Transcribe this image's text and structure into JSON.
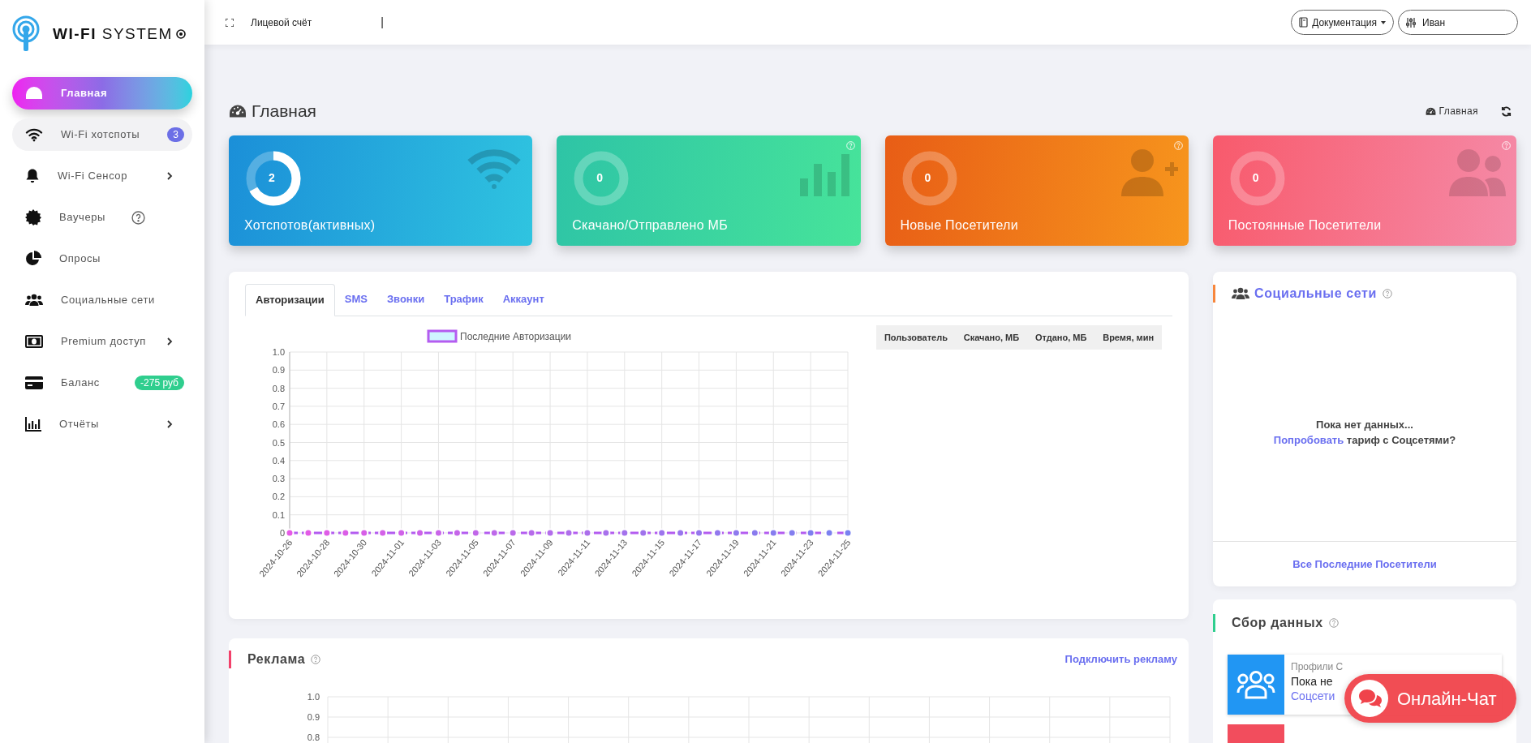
{
  "brand": {
    "title_bold": "WI-FI",
    "title_light": "SYSTEM"
  },
  "sidebar": {
    "items": [
      {
        "label": "Главная",
        "selected": true,
        "hovered": false,
        "expandable": false,
        "help": false
      },
      {
        "label": "Wi-Fi хотспоты",
        "selected": false,
        "hovered": true,
        "expandable": false,
        "help": false,
        "badge": {
          "text": "3",
          "color": "#6c6fe6"
        }
      },
      {
        "label": "Wi-Fi Сенсор",
        "selected": false,
        "hovered": false,
        "expandable": true,
        "help": false
      },
      {
        "label": "Ваучеры",
        "selected": false,
        "hovered": false,
        "expandable": false,
        "help": true
      },
      {
        "label": "Опросы",
        "selected": false,
        "hovered": false,
        "expandable": false,
        "help": false
      },
      {
        "label": "Социальные сети",
        "selected": false,
        "hovered": false,
        "expandable": false,
        "help": false
      },
      {
        "label": "Premium доступ",
        "selected": false,
        "hovered": false,
        "expandable": true,
        "help": false
      },
      {
        "label": "Баланс",
        "selected": false,
        "hovered": false,
        "expandable": false,
        "help": false,
        "badge": {
          "text": "-275 руб",
          "color": "#2fce8e"
        }
      },
      {
        "label": "Отчёты",
        "selected": false,
        "hovered": false,
        "expandable": true,
        "help": false
      }
    ]
  },
  "topbar": {
    "account_label": "Лицевой счёт",
    "separator": "|",
    "docs_button": "Документация",
    "user_field": "Иван"
  },
  "page": {
    "title": "Главная",
    "breadcrumb": "Главная"
  },
  "cards": [
    {
      "value": "2",
      "label": "Хотспотов(активных)",
      "level": 0.67,
      "help": false,
      "color": "#1b8fd8"
    },
    {
      "value": "0",
      "label": "Скачано/Отправлено МБ",
      "level": 0,
      "help": true,
      "color": "#2ec4a6"
    },
    {
      "value": "0",
      "label": "Новые Посетители",
      "level": 0,
      "help": true,
      "color": "#e85d16"
    },
    {
      "value": "0",
      "label": "Постоянные Посетители",
      "level": 0,
      "help": true,
      "color": "#f85a6c"
    }
  ],
  "stats": {
    "tabs": [
      {
        "label": "Авторизации",
        "selected": true
      },
      {
        "label": "SMS",
        "selected": false
      },
      {
        "label": "Звонки",
        "selected": false
      },
      {
        "label": "Трафик",
        "selected": false
      },
      {
        "label": "Аккаунт",
        "selected": false
      }
    ],
    "chart_data": {
      "type": "line",
      "categories": [
        "2024-10-26",
        null,
        "2024-10-28",
        null,
        "2024-10-30",
        null,
        "2024-11-01",
        null,
        "2024-11-03",
        null,
        "2024-11-05",
        null,
        "2024-11-07",
        null,
        "2024-11-09",
        null,
        "2024-11-11",
        null,
        "2024-11-13",
        null,
        "2024-11-15",
        null,
        "2024-11-17",
        null,
        "2024-11-19",
        null,
        "2024-11-21",
        null,
        "2024-11-23",
        null,
        "2024-11-25"
      ],
      "grid": true,
      "series": [
        {
          "name": "Последние Авторизации",
          "color": "#b45cf0",
          "line_style": "dashed",
          "marker": "circle",
          "values": [
            0,
            0,
            0,
            0,
            0,
            0,
            0,
            0,
            0,
            0,
            0,
            0,
            0,
            0,
            0,
            0,
            0,
            0,
            0,
            0,
            0,
            0,
            0,
            0,
            0,
            0,
            0,
            0,
            0,
            0,
            0
          ]
        }
      ],
      "ylim": [
        0,
        1
      ],
      "yticks": [
        {
          "value": 1,
          "label": "1.0"
        },
        {
          "value": 0.9,
          "label": "0.9"
        },
        {
          "value": 0.8,
          "label": "0.8"
        },
        {
          "value": 0.7,
          "label": "0.7"
        },
        {
          "value": 0.6,
          "label": "0.6"
        },
        {
          "value": 0.5,
          "label": "0.5"
        },
        {
          "value": 0.4,
          "label": "0.4"
        },
        {
          "value": 0.3,
          "label": "0.3"
        },
        {
          "value": 0.2,
          "label": "0.2"
        },
        {
          "value": 0.1,
          "label": "0.1"
        },
        {
          "value": 0,
          "label": "0"
        }
      ]
    },
    "table": {
      "columns": [
        "Пользователь",
        "Скачано, МБ",
        "Отдано, МБ",
        "Время, мин"
      ]
    }
  },
  "ads": {
    "title": "Реклама",
    "link": "Подключить рекламу",
    "axis_labels": [
      "1.0",
      "0.9",
      "0.8"
    ]
  },
  "social": {
    "title": "Социальные сети",
    "empty_text": "Пока нет данных...",
    "link": "Попробовать",
    "link_suffix": "тариф с Соцсетями?",
    "footer_link": "Все Последние Посетители"
  },
  "data_collection": {
    "title": "Сбор данных",
    "items": [
      {
        "color": "#2196f3",
        "caption": "Профили С",
        "text": "Пока не",
        "link": "Соцсети"
      },
      {
        "color": "#f24d5d"
      }
    ]
  },
  "chat": {
    "label": "Онлайн-Чат"
  }
}
